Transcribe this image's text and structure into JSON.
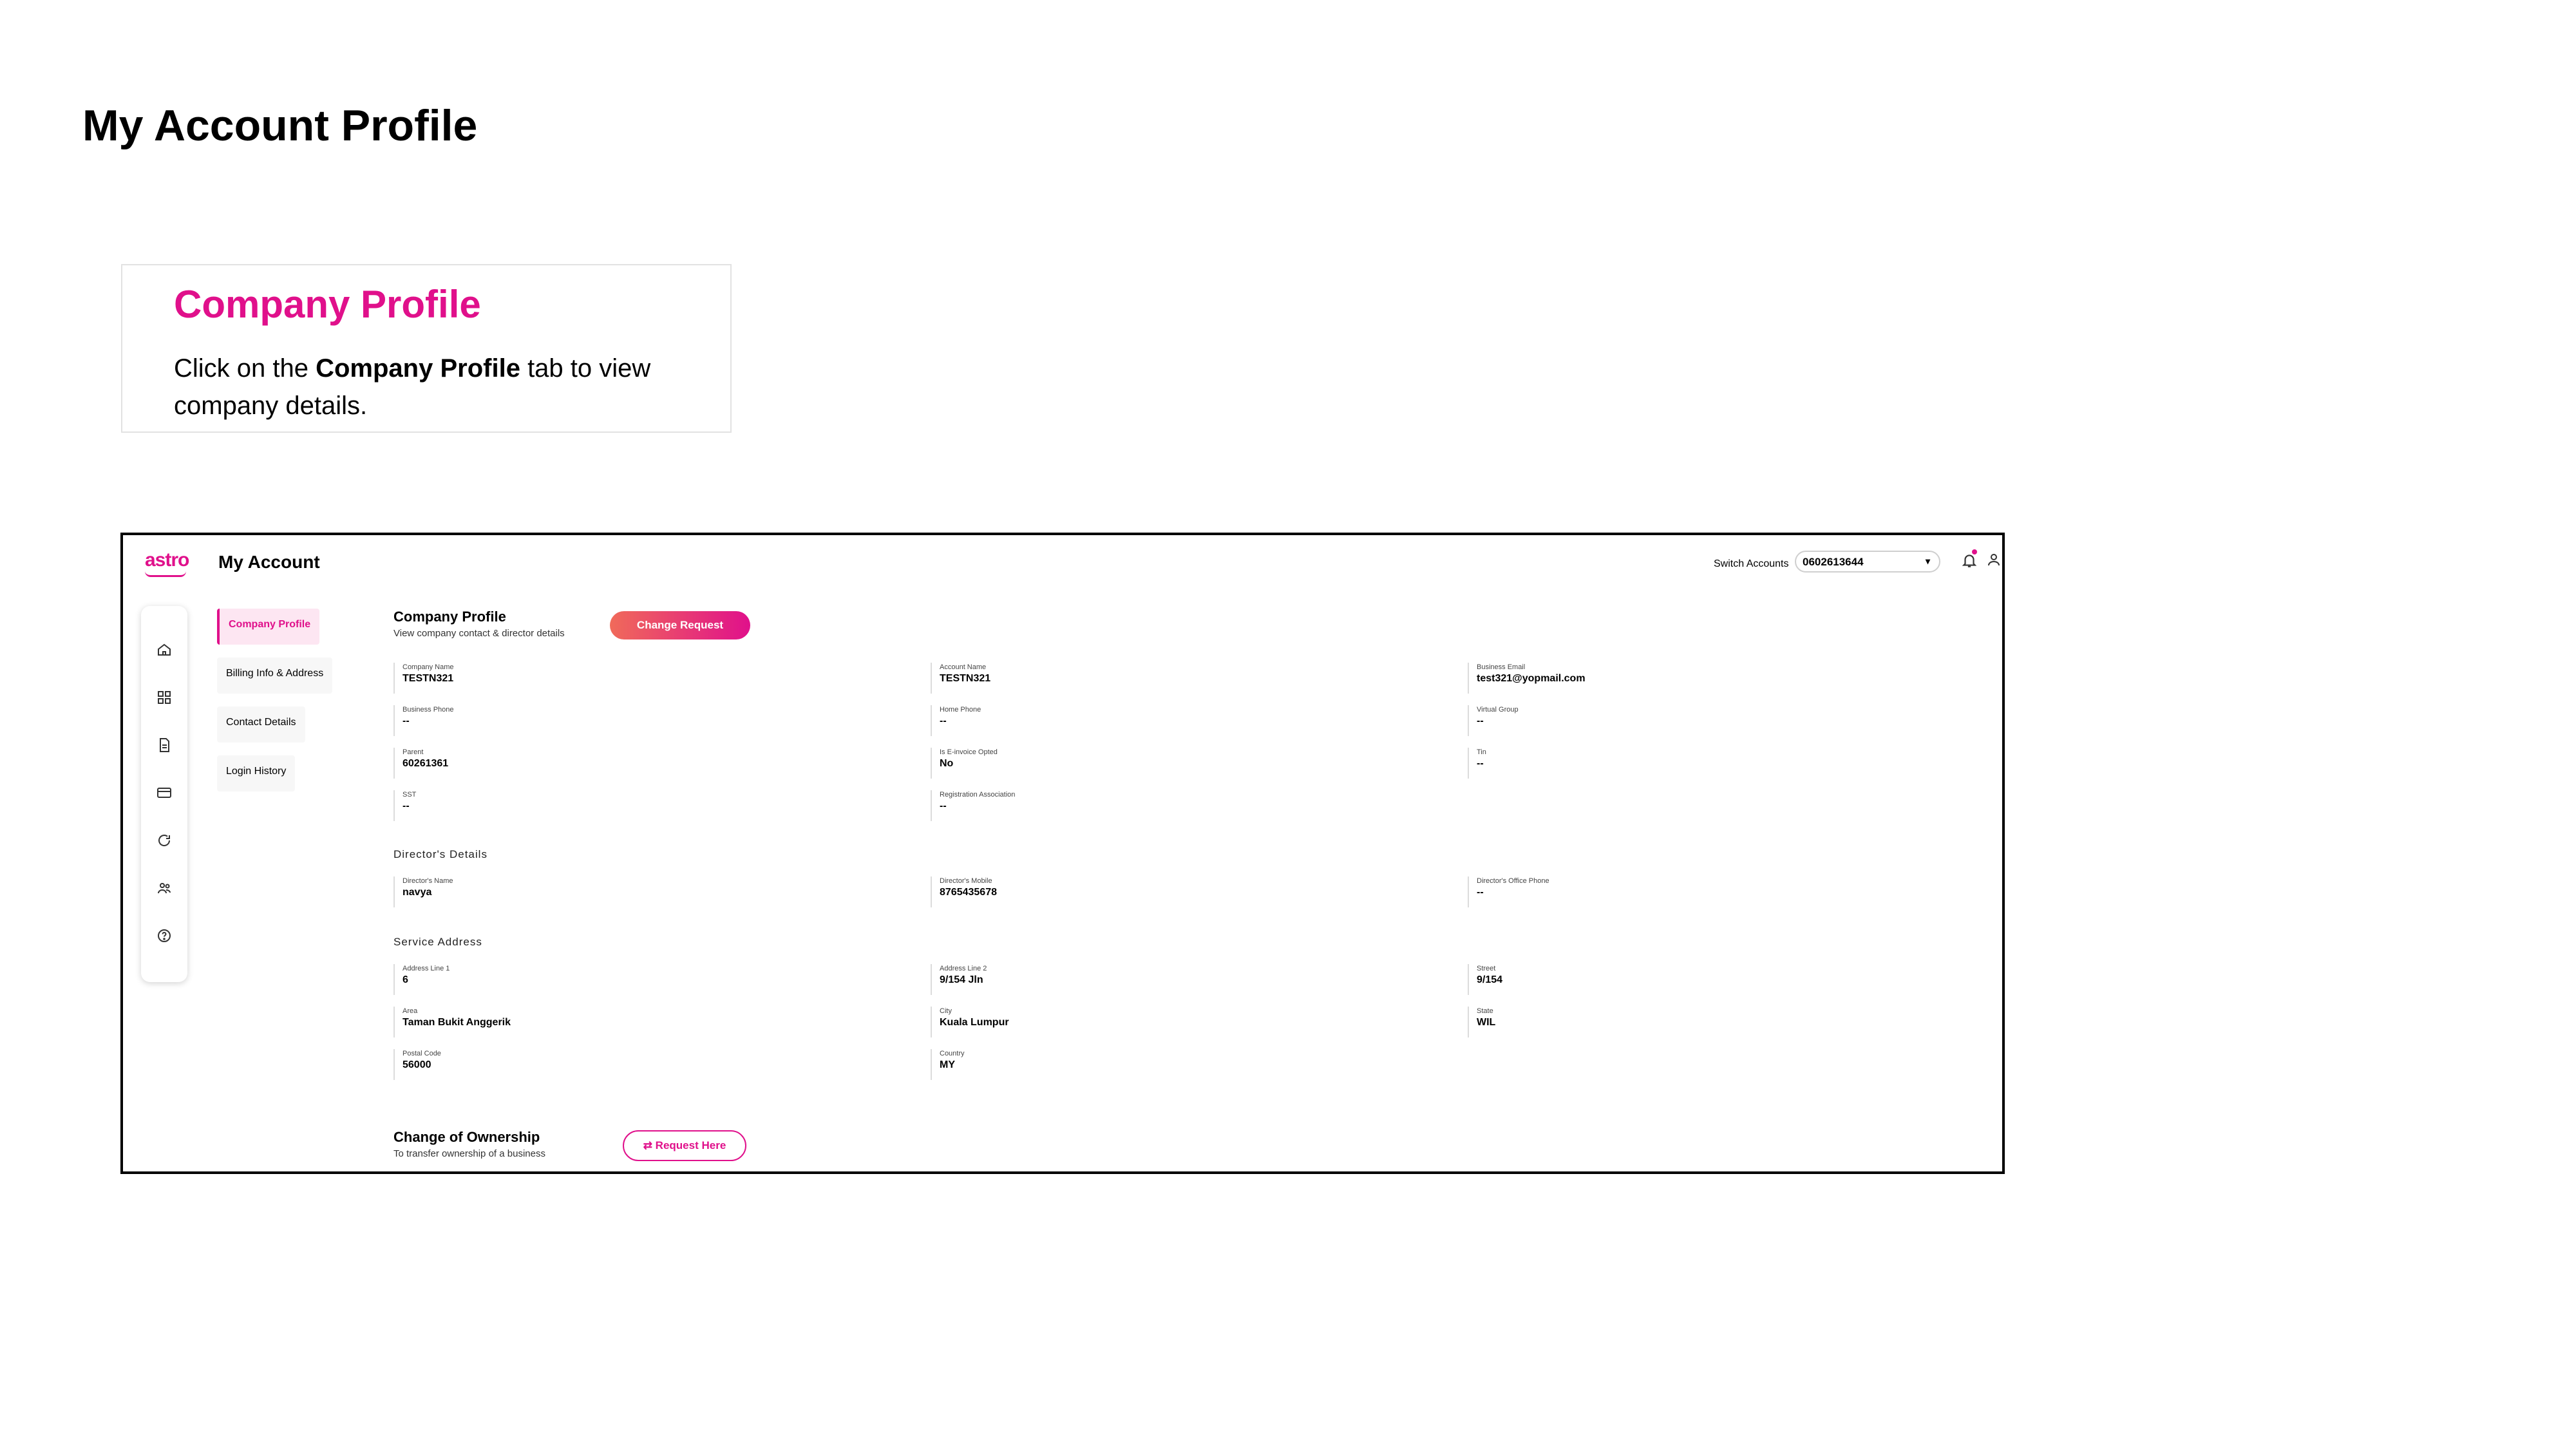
{
  "page": {
    "title": "My Account Profile",
    "callout": {
      "heading": "Company Profile",
      "text_pre": "Click on the ",
      "text_bold": "Company Profile",
      "text_post": " tab to view company details."
    }
  },
  "app": {
    "logo": "astro",
    "title": "My Account",
    "switch_label": "Switch Accounts",
    "account_number": "0602613644",
    "icons": {
      "caret": "chevron-down-icon",
      "bell": "bell-icon",
      "user": "user-icon"
    },
    "rail_icons": [
      "home-icon",
      "grid-icon",
      "document-icon",
      "card-icon",
      "refresh-icon",
      "users-icon",
      "help-icon"
    ],
    "subnav": [
      "Company Profile",
      "Billing Info & Address",
      "Contact Details",
      "Login History"
    ],
    "accent_color": "#e0108b"
  },
  "company_profile": {
    "title": "Company Profile",
    "subtitle": "View company contact & director details",
    "change_button": "Change Request",
    "fields": [
      {
        "label": "Company Name",
        "value": "TESTN321"
      },
      {
        "label": "Account Name",
        "value": "TESTN321"
      },
      {
        "label": "Business Email",
        "value": "test321@yopmail.com"
      },
      {
        "label": "Business Phone",
        "value": "--"
      },
      {
        "label": "Home Phone",
        "value": "--"
      },
      {
        "label": "Virtual Group",
        "value": "--"
      },
      {
        "label": "Parent",
        "value": "60261361"
      },
      {
        "label": "Is E-invoice Opted",
        "value": "No"
      },
      {
        "label": "Tin",
        "value": "--"
      },
      {
        "label": "SST",
        "value": "--"
      },
      {
        "label": "Registration Association",
        "value": "--"
      }
    ]
  },
  "directors": {
    "title": "Director's Details",
    "fields": [
      {
        "label": "Director's Name",
        "value": "navya"
      },
      {
        "label": "Director's Mobile",
        "value": "8765435678"
      },
      {
        "label": "Director's Office Phone",
        "value": "--"
      }
    ]
  },
  "service_address": {
    "title": "Service Address",
    "fields": [
      {
        "label": "Address Line 1",
        "value": "6"
      },
      {
        "label": "Address Line 2",
        "value": "9/154 Jln"
      },
      {
        "label": "Street",
        "value": "9/154"
      },
      {
        "label": "Area",
        "value": "Taman Bukit Anggerik"
      },
      {
        "label": "City",
        "value": "Kuala Lumpur"
      },
      {
        "label": "State",
        "value": "WIL"
      },
      {
        "label": "Postal Code",
        "value": "56000"
      },
      {
        "label": "Country",
        "value": "MY"
      }
    ]
  },
  "ownership": {
    "title": "Change of Ownership",
    "subtitle": "To transfer ownership of a business",
    "button": "Request Here",
    "button_icon": "swap-icon"
  }
}
